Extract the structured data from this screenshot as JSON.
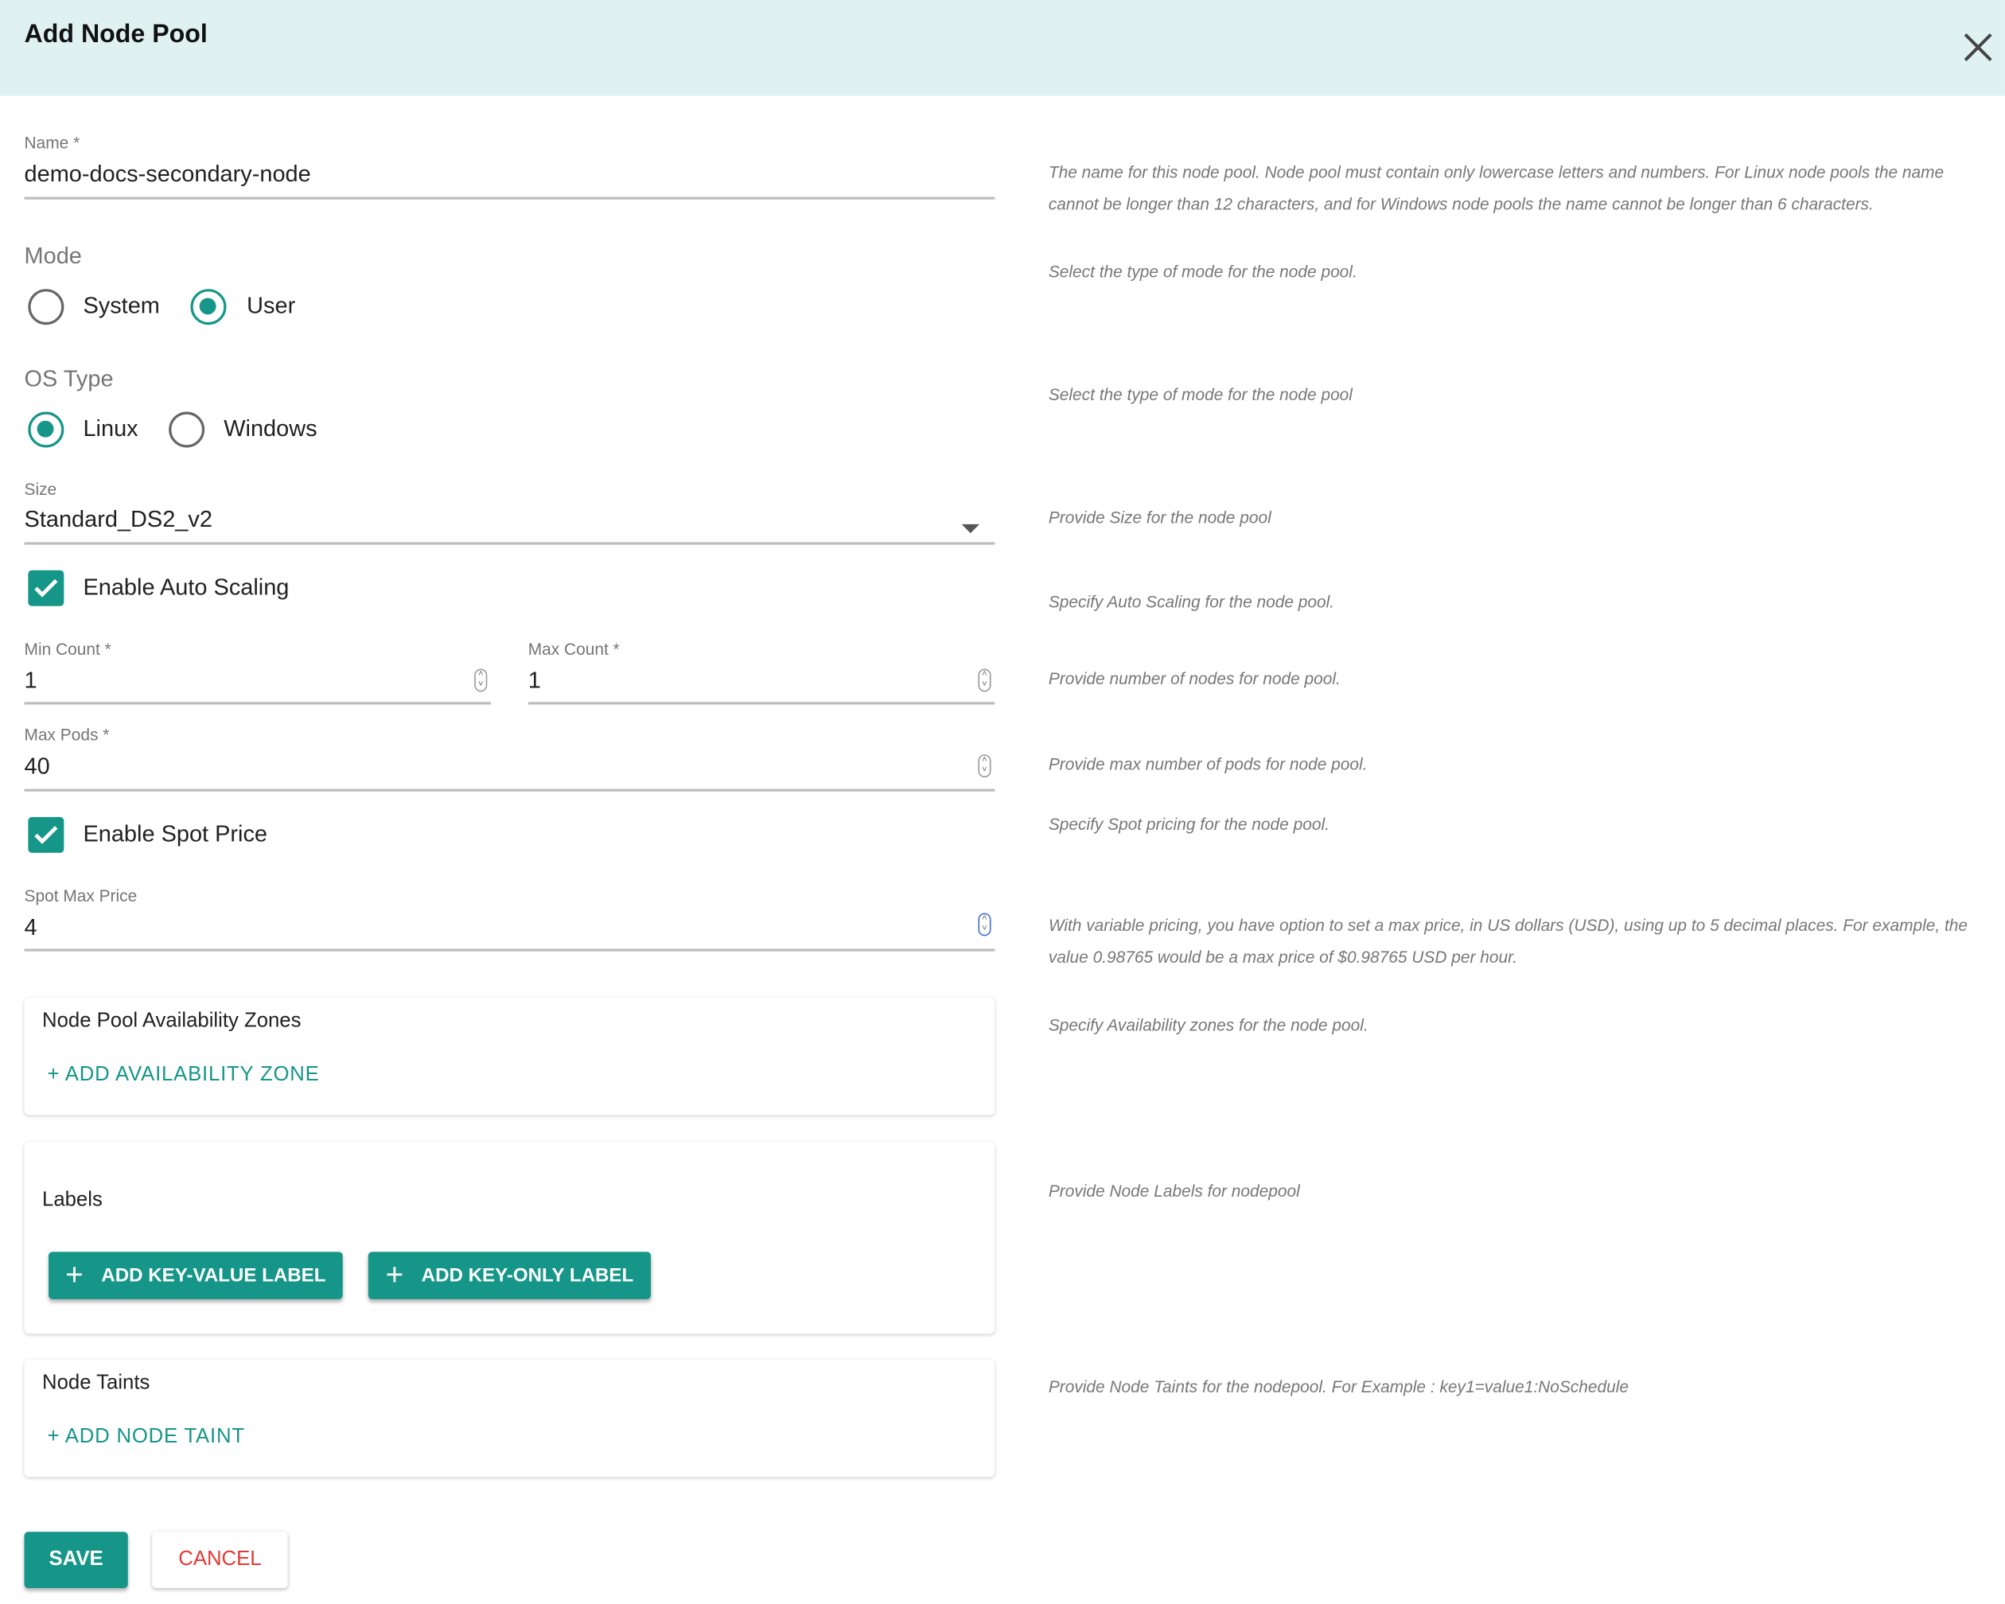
{
  "dialog": {
    "title": "Add Node Pool",
    "close_icon": "close-icon"
  },
  "colors": {
    "accent": "#159688",
    "header_bg": "#dff2f1",
    "cancel": "#e53935"
  },
  "name": {
    "label": "Name *",
    "value": "demo-docs-secondary-node",
    "help": "The name for this node pool. Node pool must contain only lowercase letters and numbers. For Linux node pools the name cannot be longer than 12 characters, and for Windows node pools the name cannot be longer than 6 characters."
  },
  "mode": {
    "label": "Mode",
    "options": [
      {
        "label": "System",
        "selected": false
      },
      {
        "label": "User",
        "selected": true
      }
    ],
    "help": "Select the type of mode for the node pool."
  },
  "os_type": {
    "label": "OS Type",
    "options": [
      {
        "label": "Linux",
        "selected": true
      },
      {
        "label": "Windows",
        "selected": false
      }
    ],
    "help": "Select the type of mode for the node pool"
  },
  "size": {
    "label": "Size",
    "value": "Standard_DS2_v2",
    "help": "Provide Size for the node pool"
  },
  "auto_scaling": {
    "label": "Enable Auto Scaling",
    "checked": true,
    "help": "Specify Auto Scaling for the node pool."
  },
  "min_count": {
    "label": "Min Count *",
    "value": "1"
  },
  "max_count": {
    "label": "Max Count *",
    "value": "1",
    "help": "Provide number of nodes for node pool."
  },
  "max_pods": {
    "label": "Max Pods *",
    "value": "40",
    "help": "Provide max number of pods for node pool."
  },
  "spot_price": {
    "label": "Enable Spot Price",
    "checked": true,
    "help": "Specify Spot pricing for the node pool."
  },
  "spot_max_price": {
    "label": "Spot Max Price",
    "value": "4",
    "help": "With variable pricing, you have option to set a max price, in US dollars (USD), using up to 5 decimal places. For example, the value 0.98765 would be a max price of $0.98765 USD per hour."
  },
  "availability_zones": {
    "title": "Node Pool Availability Zones",
    "add_label": "+ ADD  AVAILABILITY ZONE",
    "help": "Specify Availability zones for the node pool."
  },
  "labels": {
    "title": "Labels",
    "add_key_value": "ADD KEY-VALUE LABEL",
    "add_key_only": "ADD KEY-ONLY LABEL",
    "help": "Provide Node Labels for nodepool"
  },
  "taints": {
    "title": "Node Taints",
    "add_label": "+ ADD  NODE TAINT",
    "help": "Provide Node Taints for the nodepool. For Example : key1=value1:NoSchedule"
  },
  "footer": {
    "save": "SAVE",
    "cancel": "CANCEL"
  }
}
